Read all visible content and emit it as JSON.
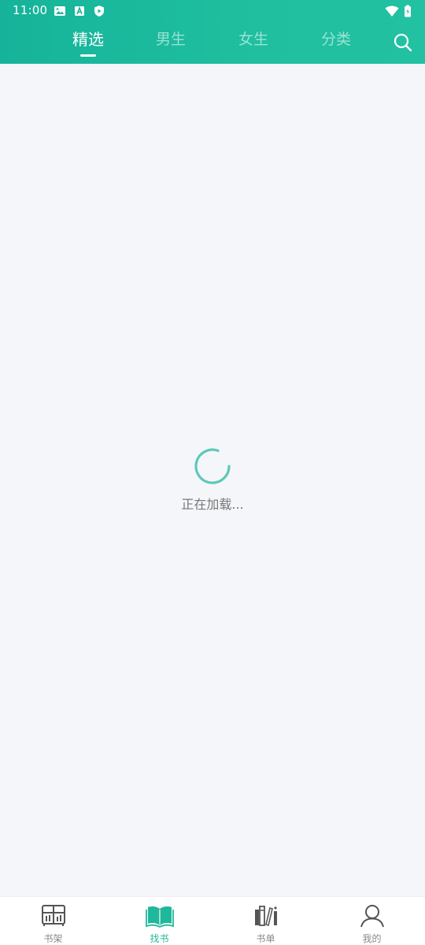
{
  "status_bar": {
    "time": "11:00",
    "left_icons": [
      "image-icon",
      "a-badge-icon",
      "shield-play-icon"
    ],
    "right_icons": [
      "wifi-icon",
      "battery-icon"
    ]
  },
  "header": {
    "tabs": [
      {
        "label": "精选",
        "active": true
      },
      {
        "label": "男生",
        "active": false
      },
      {
        "label": "女生",
        "active": false
      },
      {
        "label": "分类",
        "active": false
      }
    ],
    "search_icon": "search-icon",
    "colors": {
      "accent_start": "#16b39a",
      "accent_end": "#21c1a2"
    }
  },
  "content": {
    "loading_text": "正在加载...",
    "spinner_color": "#5cc9b8"
  },
  "bottom_nav": {
    "items": [
      {
        "label": "书架",
        "icon": "bookshelf-icon",
        "active": false
      },
      {
        "label": "找书",
        "icon": "open-book-icon",
        "active": true
      },
      {
        "label": "书单",
        "icon": "book-list-icon",
        "active": false
      },
      {
        "label": "我的",
        "icon": "user-icon",
        "active": false
      }
    ],
    "active_color": "#1fb89b"
  }
}
